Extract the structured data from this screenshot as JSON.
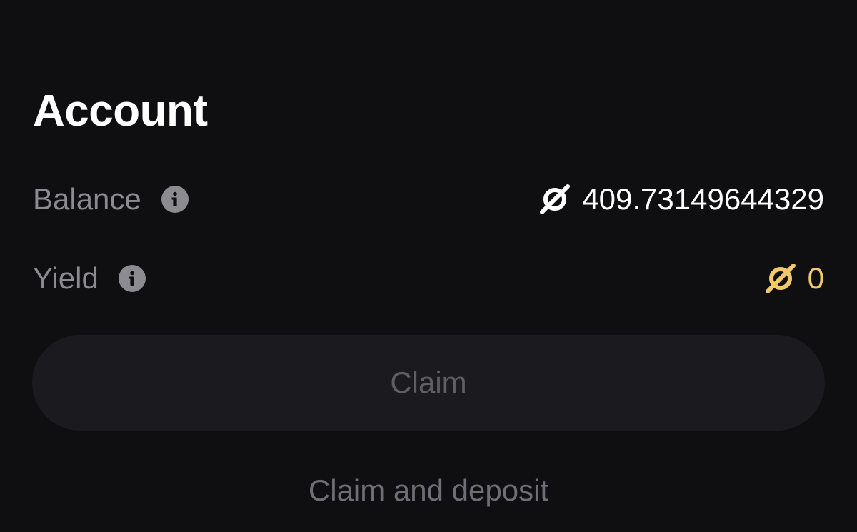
{
  "account": {
    "title": "Account"
  },
  "balance": {
    "label": "Balance",
    "info_icon": "info-icon",
    "token_icon": "token-icon",
    "value": "409.73149644329",
    "value_color": "#ffffff"
  },
  "yield": {
    "label": "Yield",
    "info_icon": "info-icon",
    "token_icon": "token-icon",
    "value": "0",
    "value_color": "#f1c86a"
  },
  "actions": {
    "claim_label": "Claim",
    "claim_and_deposit_label": "Claim and deposit"
  },
  "theme": {
    "background": "#0f0f11",
    "muted_label": "#8b8b90",
    "button_bg": "#1b1b1f",
    "accent_gold": "#f1c86a"
  }
}
